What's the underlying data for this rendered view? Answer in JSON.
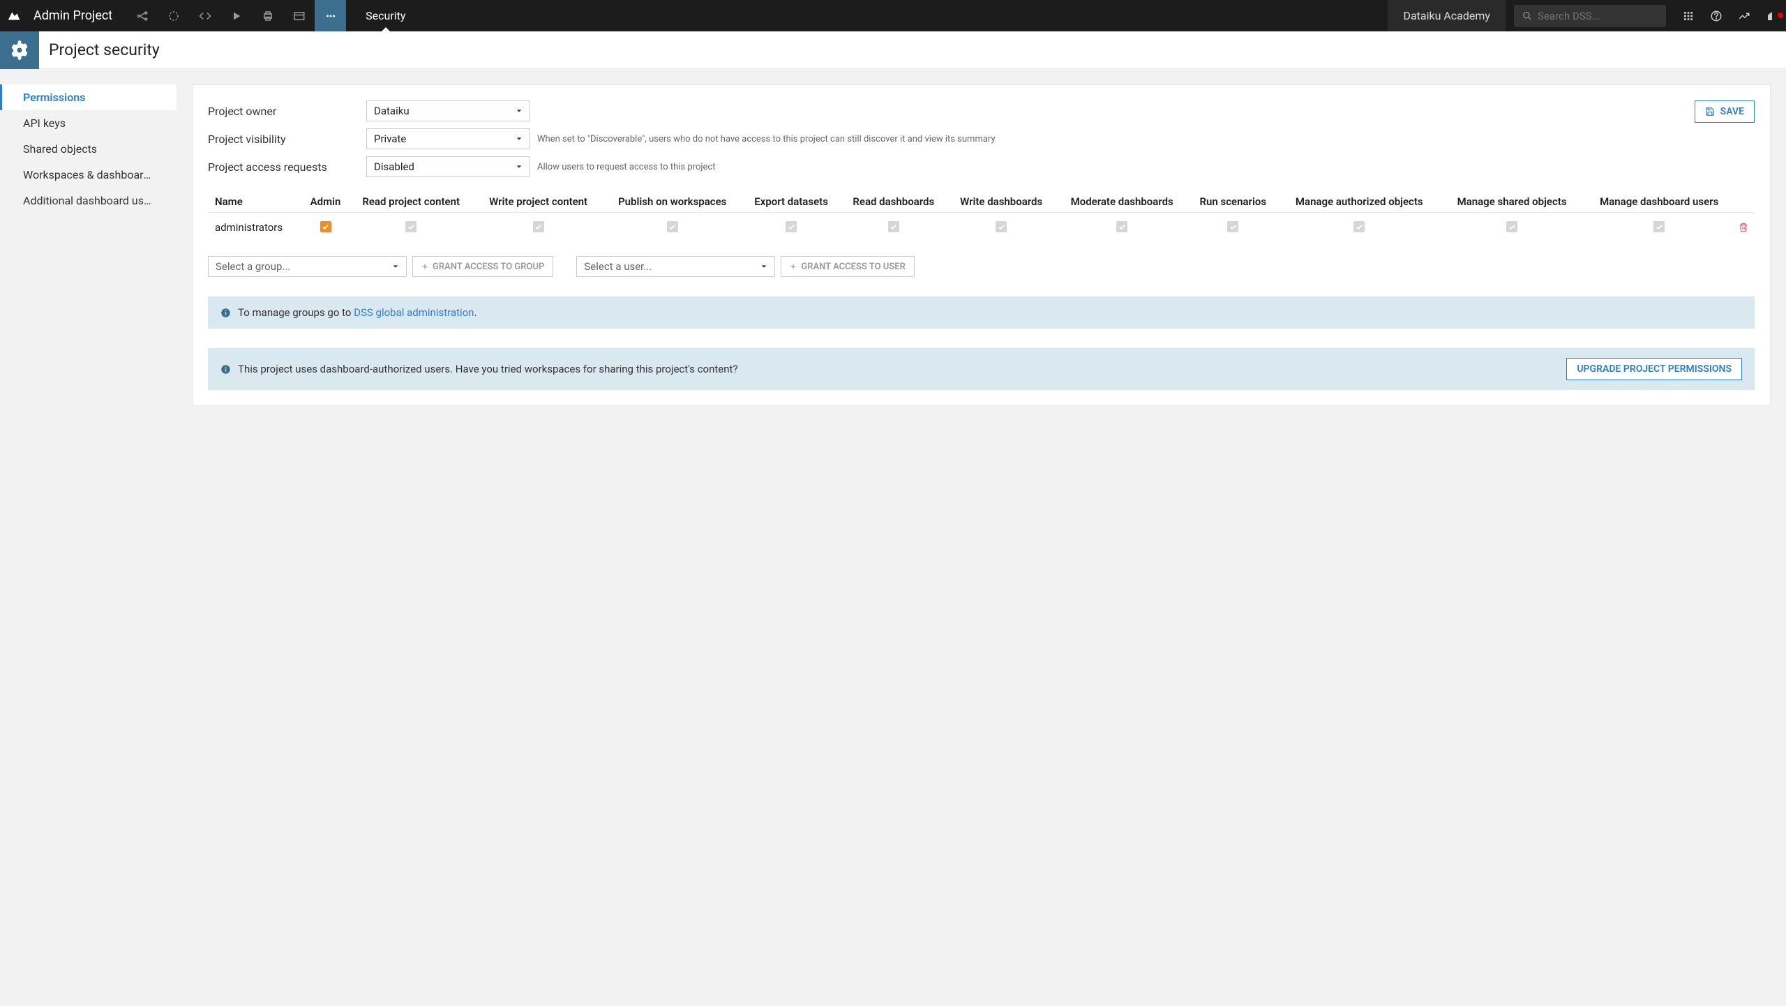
{
  "topbar": {
    "project_name": "Admin Project",
    "tab_label": "Security",
    "academy_label": "Dataiku Academy",
    "search_placeholder": "Search DSS..."
  },
  "page": {
    "title": "Project security"
  },
  "sidebar": {
    "items": [
      {
        "label": "Permissions"
      },
      {
        "label": "API keys"
      },
      {
        "label": "Shared objects"
      },
      {
        "label": "Workspaces & dashboards au…"
      },
      {
        "label": "Additional dashboard users"
      }
    ]
  },
  "form": {
    "owner_label": "Project owner",
    "owner_value": "Dataiku",
    "visibility_label": "Project visibility",
    "visibility_value": "Private",
    "visibility_help": "When set to \"Discoverable\", users who do not have access to this project can still discover it and view its summary",
    "access_label": "Project access requests",
    "access_value": "Disabled",
    "access_help": "Allow users to request access to this project",
    "save_label": "SAVE"
  },
  "table": {
    "headers": [
      "Name",
      "Admin",
      "Read project content",
      "Write project content",
      "Publish on workspaces",
      "Export datasets",
      "Read dashboards",
      "Write dashboards",
      "Moderate dashboards",
      "Run scenarios",
      "Manage authorized objects",
      "Manage shared objects",
      "Manage dashboard users"
    ],
    "row_name": "administrators"
  },
  "grant": {
    "group_placeholder": "Select a group...",
    "group_btn": "GRANT ACCESS TO GROUP",
    "user_placeholder": "Select a user...",
    "user_btn": "GRANT ACCESS TO USER"
  },
  "info1": {
    "prefix": "To manage groups go to ",
    "link": "DSS global administration",
    "suffix": "."
  },
  "info2": {
    "text": "This project uses dashboard-authorized users. Have you tried workspaces for sharing this project's content?",
    "btn": "UPGRADE PROJECT PERMISSIONS"
  }
}
